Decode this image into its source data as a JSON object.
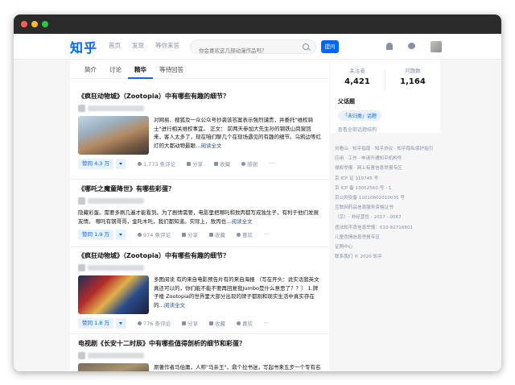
{
  "header": {
    "logo": "知乎",
    "nav": [
      "首页",
      "发现",
      "等你来答"
    ],
    "search_placeholder": "你会喜欢这几部动漫作品吗？",
    "ask_label": "提问"
  },
  "tabs": [
    "简介",
    "讨论",
    "精华",
    "等待回答"
  ],
  "active_tab": "精华",
  "answers": [
    {
      "title": "《疯狂动物城》（Zootopia）中有哪些有趣的细节？",
      "excerpt": "对网易、搜狐及一众公众号抄袭该答案表示强烈谴责，并委托\"维权骑士\"进行相关维权事宜。 正文：  前两天参加大先生孙的钢铁山岗窗回来，客人太多了，现在咱们聊几个在现场遇见的有趣的细节。乌鸦边等红灯的大都动物最眼…",
      "more": "阅读全文",
      "votes": "赞同 4.3 万",
      "comments": "1,773 条评论",
      "share": "分享",
      "fav": "收藏",
      "thanks": "感谢"
    },
    {
      "title": "《哪吒之魔童降世》有哪些彩蛋？",
      "excerpt": "隐藏彩蛋。需要多刷几遍才能看到。为了剧情需要，电影里把哪吒和敖丙都写成独生子，有利于他们发展友情。 哪吒有钢哥哥，金吒木吒，我们都知道。实际上，敖丙也…",
      "more": "阅读全文",
      "votes": "赞同 1.9 万",
      "comments": "974 条评论",
      "share": "分享",
      "fav": "收藏",
      "thanks": "喜欢"
    },
    {
      "title": "《疯狂动物城》（Zootopia）中有哪些有趣的细节？",
      "excerpt": "多图阅读 有的来自电影预告片有的来自海报 （写在开头：说实话我英文真还可以的，你们能不能不要再回复我Jumbo是什么意思了？？） 1.牌子楼 Zootopia的世界里大部分出现的牌子都刚和现实生活中真实存在的…",
      "more": "阅读全文",
      "votes": "赞同 1.8 万",
      "comments": "776 条评论",
      "share": "分享",
      "fav": "收藏",
      "thanks": "喜欢"
    },
    {
      "title": "电视剧《长安十二时辰》中有哪些值得剖析的细节和彩蛋？",
      "excerpt": "原著作者马伯庸，人称\"马亲王\"，鼎个拉书迷，写起书来五步一个专有名词，十步一个冷门知识，恨不能将毕生所学都在故事情节"
    }
  ],
  "sidebar": {
    "followers_label": "关注者",
    "followers": "4,421",
    "questions_label": "问题数",
    "questions": "1,164",
    "parent_title": "父话题",
    "parent_topic": "「未归类」话题",
    "all_parent_link": "查看全部话题结构"
  },
  "footer_lines": [
    "刘看山 · 知乎指南 · 知乎协议 · 知乎隐私保护指引",
    "应用 · 工作 · 申请开通知乎机构号",
    "侵权举报 · 网上有害信息举报专区",
    "京 ICP 证 110745 号",
    "京 ICP 备 13052560 号 - 1",
    "京公网安备 11010802010035 号",
    "互联网药品信息服务资格证书",
    "（京）- 非经营性 - 2017 - 0067",
    "违法和不良信息举报：010-82716601",
    "儿童色情信息举报专区",
    "证照中心",
    "联系我们 © 2020 知乎"
  ]
}
